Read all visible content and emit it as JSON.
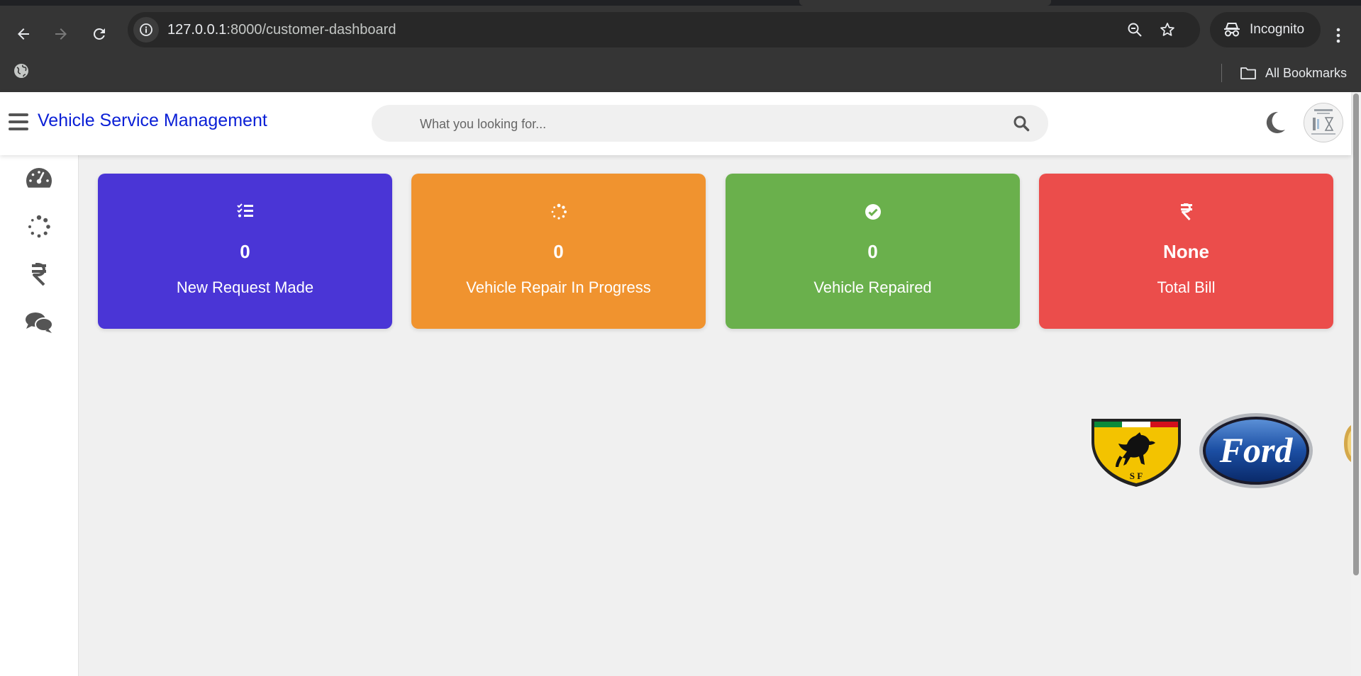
{
  "browser": {
    "url_host": "127.0.0.1",
    "url_path": ":8000/customer-dashboard",
    "incognito_label": "Incognito",
    "bookmarks_label": "All Bookmarks"
  },
  "header": {
    "brand": "Vehicle Service Management",
    "search_placeholder": "What you looking for..."
  },
  "sidebar": {
    "items": [
      "dashboard-icon",
      "spinner-icon",
      "rupee-icon",
      "chat-icon"
    ]
  },
  "cards": [
    {
      "value": "0",
      "label": "New Request Made",
      "color": "#4a35d6",
      "icon": "checklist-icon"
    },
    {
      "value": "0",
      "label": "Vehicle Repair In Progress",
      "color": "#f0932f",
      "icon": "spinner-icon"
    },
    {
      "value": "0",
      "label": "Vehicle Repaired",
      "color": "#6ab04c",
      "icon": "check-circle-icon"
    },
    {
      "value": "None",
      "label": "Total Bill",
      "color": "#eb4d4b",
      "icon": "rupee-icon"
    }
  ],
  "brand_logos": {
    "ferrari_text": "S F",
    "ford_text": "Ford"
  }
}
